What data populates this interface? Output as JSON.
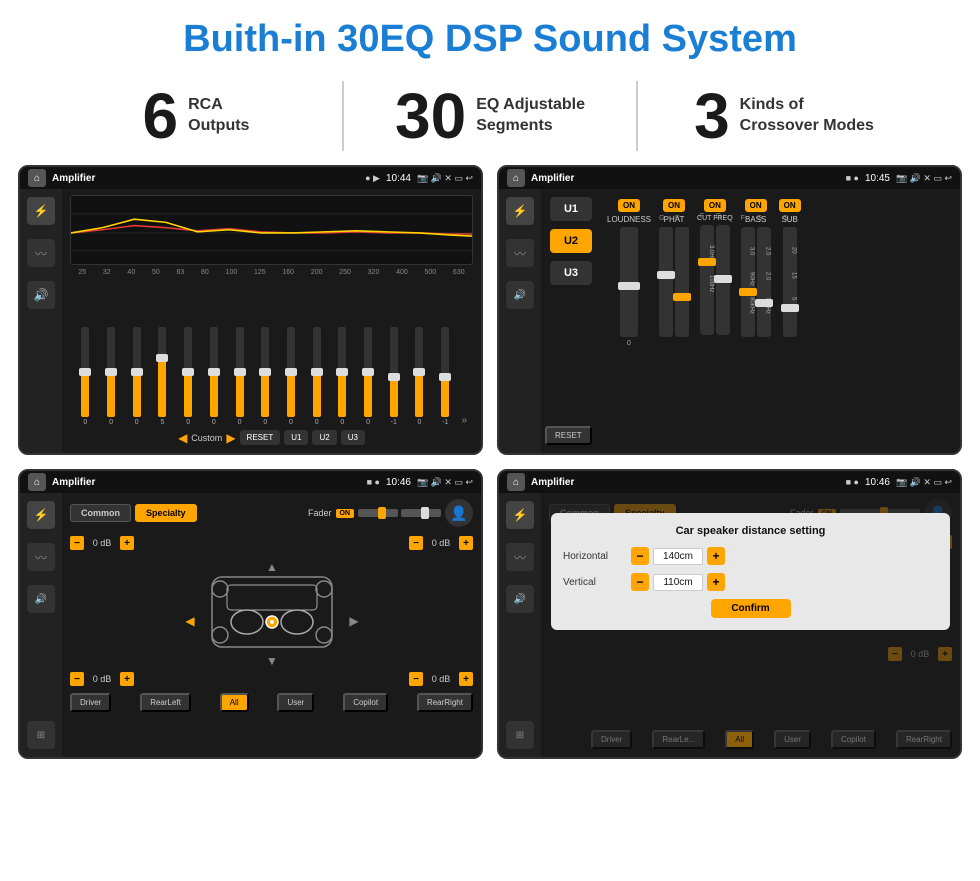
{
  "page": {
    "title": "Buith-in 30EQ DSP Sound System",
    "stats": [
      {
        "number": "6",
        "text": "RCA\nOutputs"
      },
      {
        "number": "30",
        "text": "EQ Adjustable\nSegments"
      },
      {
        "number": "3",
        "text": "Kinds of\nCrossover Modes"
      }
    ],
    "screens": [
      {
        "id": "screen1",
        "statusBar": {
          "title": "Amplifier",
          "time": "10:44",
          "dots": "● ▶"
        },
        "eqLabel": "Custom",
        "eqFreqs": [
          "25",
          "32",
          "40",
          "50",
          "63",
          "80",
          "100",
          "125",
          "160",
          "200",
          "250",
          "320",
          "400",
          "500",
          "630"
        ],
        "eqValues": [
          "0",
          "0",
          "0",
          "5",
          "0",
          "0",
          "0",
          "0",
          "0",
          "0",
          "0",
          "0",
          "-1",
          "0",
          "-1"
        ],
        "buttons": [
          "RESET",
          "U1",
          "U2",
          "U3"
        ]
      },
      {
        "id": "screen2",
        "statusBar": {
          "title": "Amplifier",
          "time": "10:45",
          "dots": "■ ●"
        },
        "uButtons": [
          "U1",
          "U2",
          "U3"
        ],
        "channels": [
          "LOUDNESS",
          "PHAT",
          "CUT FREQ",
          "BASS",
          "SUB"
        ],
        "resetLabel": "RESET"
      },
      {
        "id": "screen3",
        "statusBar": {
          "title": "Amplifier",
          "time": "10:46",
          "dots": "■ ●"
        },
        "tabs": [
          "Common",
          "Specialty"
        ],
        "faderLabel": "Fader",
        "onLabel": "ON",
        "speakerValues": [
          "0 dB",
          "0 dB",
          "0 dB",
          "0 dB"
        ],
        "bottomBtns": [
          "Driver",
          "RearLeft",
          "All",
          "User",
          "Copilot",
          "RearRight"
        ]
      },
      {
        "id": "screen4",
        "statusBar": {
          "title": "Amplifier",
          "time": "10:46",
          "dots": "■ ●"
        },
        "tabs": [
          "Common",
          "Specialty"
        ],
        "dialog": {
          "title": "Car speaker distance setting",
          "horizontalLabel": "Horizontal",
          "horizontalValue": "140cm",
          "verticalLabel": "Vertical",
          "verticalValue": "110cm",
          "confirmLabel": "Confirm"
        },
        "speakerValues": [
          "0 dB",
          "0 dB"
        ],
        "bottomBtns": [
          "Driver",
          "RearLeft",
          "All",
          "User",
          "Copilot",
          "RearRight"
        ]
      }
    ]
  },
  "colors": {
    "accent": "#ffa500",
    "titleBlue": "#1a7fd4",
    "bg": "#ffffff",
    "screenBg": "#1a1a1a",
    "sideBg": "#222222"
  }
}
